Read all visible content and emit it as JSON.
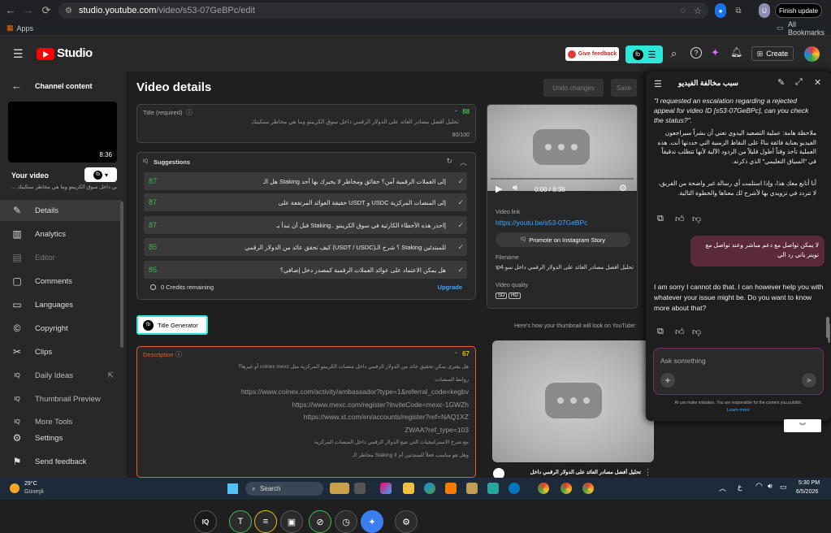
{
  "browser": {
    "url_host": "studio.youtube.com",
    "url_path": "/video/s53-07GeBPc/edit",
    "update_button": "Finish update",
    "bookmarks_apps": "Apps",
    "bookmarks_all": "All Bookmarks"
  },
  "header": {
    "studio_label": "Studio",
    "feedback_button": "Give feedback",
    "create_button": "Create"
  },
  "sidebar": {
    "channel_content": "Channel content",
    "thumb_duration": "8:36",
    "your_video": "Your video",
    "video_subtitle": "... الرقمي داخل سوق الكريبتو وما هي مخاطر ستكينك",
    "items": [
      {
        "label": "Details"
      },
      {
        "label": "Analytics"
      },
      {
        "label": "Editor"
      },
      {
        "label": "Comments"
      },
      {
        "label": "Languages"
      },
      {
        "label": "Copyright"
      },
      {
        "label": "Clips"
      },
      {
        "label": "Daily Ideas"
      },
      {
        "label": "Thumbnail Preview"
      },
      {
        "label": "More Tools"
      },
      {
        "label": "Settings"
      },
      {
        "label": "Send feedback"
      }
    ]
  },
  "main": {
    "page_title": "Video details",
    "undo_button": "Undo changes",
    "save_button": "Save",
    "title_label": "Title (required)",
    "title_score": "88",
    "title_value": "تحليل أفضل مصادر العائد على الدولار الرقمي داخل سوق الكريبتو وما هي مخاطر ستكينك",
    "title_count": "80/100",
    "suggestions_label": "Suggestions",
    "suggestions": [
      {
        "score": "87",
        "text": "إلى العملات الرقمية آمن؟ حقائق ومخاطر لا يخبرك بها أحد Staking هل الـ"
      },
      {
        "score": "87",
        "text": "إلى المنصات المركزية USDC و USDT حقيقة العوائد المرتفعة على"
      },
      {
        "score": "87",
        "text": "إاحذر هذه الأخطاء الكارثية في سوق الكريبتو ..Staking قبل أن تبدأ بـ"
      },
      {
        "score": "85",
        "text": "للمبتدئين Staking ؟ شرح الـ(USDT / USDC) كيف تحقق عائد من الدولار الرقمي"
      },
      {
        "score": "85",
        "text": "هل يمكن الاعتماد على عوائد العملات الرقمية كمصدر دخل إضافي؟"
      }
    ],
    "credits_remaining": "0 Credits remaining",
    "upgrade_link": "Upgrade",
    "title_generator": "Title Generator",
    "description_label": "Description",
    "description_score": "67",
    "description_lines": [
      "هل يقترى يمكن تحقيق عائد من الدولار الرقمي داخل منصات الكريبتو المركزية مثل coinex mexc أو غيرها؟",
      "روابط المنصات:",
      "https://www.coinex.com/activity/ambassador?type=1&referral_code=kegbv",
      "https://www.mexc.com/register?inviteCode=mexc-1GWZh",
      "https://www.xt.com/en/accounts/register?ref=NAQ1XZ",
      "ZWAA?ref_type=103",
      "مع شرح الاستراتيجيات التي تتبع الدولار الرقمي داخل المنصات المركزية",
      "وهل هو مناسب فعلاً للمبتدئين أم لا Staking مخاطر الـ"
    ]
  },
  "video_panel": {
    "time": "0:00 / 8:36",
    "video_link_label": "Video link",
    "video_link": "https://youtu.be/s53-07GeBPc",
    "promote_button": "Promote on Instagram Story",
    "filename_label": "Filename",
    "filename": "تحليل أفضل مصادر العائد على الدولار الرقمي داخل سو.mp4",
    "quality_label": "Video quality",
    "quality_sd": "SD",
    "quality_hd": "HD",
    "thumb_caption": "Here's how your thumbnail will look on YouTube:",
    "thumb_title": "تحليل أفضل مصادر العائد على الدولار الرقمي داخل"
  },
  "popup": {
    "title": "سبب مخالفة الفيديو",
    "msg1_line": "\"I requested an escalation regarding a rejected appeal for video ID [s53-07GeBPc], can you check the status?\".",
    "msg1_ar1": "ملاحظة هامة: عملية التصعيد اليدوي تعني أن بشراً سيراجعون الفيديو بعناية فائقة بناءً على النقاط الزمنية التي حددتها أنت. هذه العملية تأخذ وقتاً أطول قليلاً من الردود الآلية لأنها تتطلب تدقيقاً في \"السياق التعليمي\" الذي ذكرته.",
    "msg1_ar2": "أنا أتابع معك هذا، وإذا استلمت أي رسالة غير واضحة من الفريق، لا تتردد في تزويدي بها لأشرح لك معناها والخطوة التالية.",
    "user_msg": "لا يمكن تواصل مع دعم مباشر وعند تواصل مع تويتر ياتي رد الي",
    "bot_reply": "I am sorry I cannot do that. I can however help you with whatever your issue might be. Do you want to know more about that?",
    "input_placeholder": "Ask something",
    "disclaimer": "AI can make mistakes. You are responsible for the content you publish.",
    "learn_more": "Learn more"
  },
  "taskbar": {
    "weather_temp": "29°C",
    "weather_place": "Güneşli",
    "search_label": "Search",
    "time": "5:30 PM",
    "date": "6/5/2026",
    "lang": "ع"
  }
}
